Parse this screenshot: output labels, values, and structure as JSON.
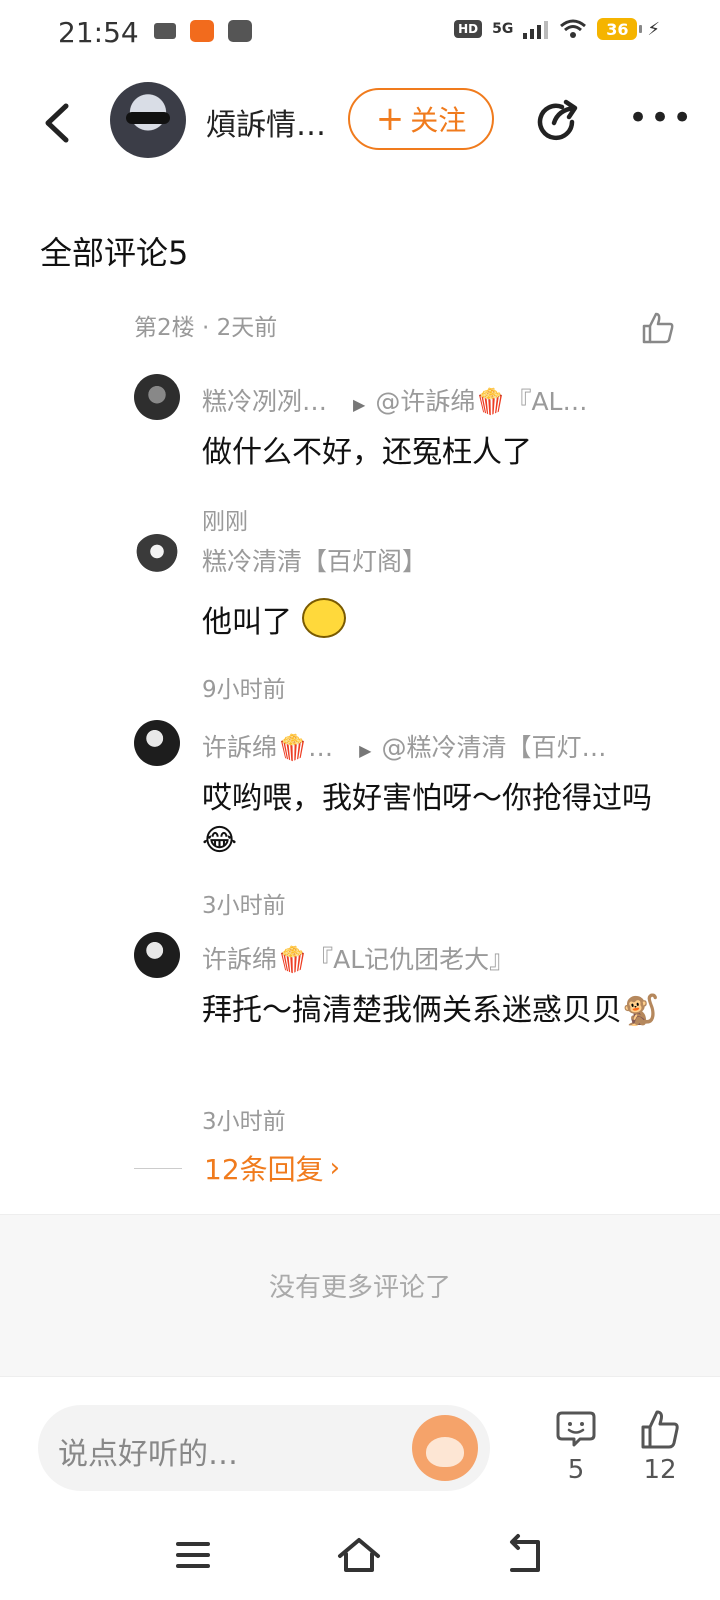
{
  "status_bar": {
    "time": "21:54",
    "network": "5G",
    "hd": "HD",
    "battery": "36"
  },
  "header": {
    "author_name": "熕訴情…",
    "follow_label": "关注",
    "icons": [
      "back-icon",
      "share-icon",
      "more-icon"
    ]
  },
  "comments": {
    "title": "全部评论5",
    "floor_info": "第2楼 · 2天前",
    "replies": [
      {
        "user": "糕冷冽冽…",
        "reply_to": "@许訴绵🍿『AL…",
        "text": "做什么不好，还冤枉人了",
        "time": "刚刚"
      },
      {
        "user": "糕冷清清【百灯阁】",
        "reply_to": "",
        "text": "他叫了",
        "time": "9小时前"
      },
      {
        "user": "许訴绵🍿…",
        "reply_to": "@糕冷清清【百灯…",
        "text": "哎哟喂，我好害怕呀～你抢得过吗😂",
        "time": "3小时前"
      },
      {
        "user": "许訴绵🍿『AL记仇团老大』",
        "reply_to": "",
        "text": "拜托～搞清楚我俩关系迷惑贝贝🐒",
        "time": "3小时前"
      }
    ],
    "more_replies": "12条回复",
    "no_more": "没有更多评论了"
  },
  "bottom_bar": {
    "input_placeholder": "说点好听的…",
    "comment_count": "5",
    "like_count": "12"
  },
  "colors": {
    "accent": "#f07b1d",
    "muted_text": "#9a9a9a"
  }
}
